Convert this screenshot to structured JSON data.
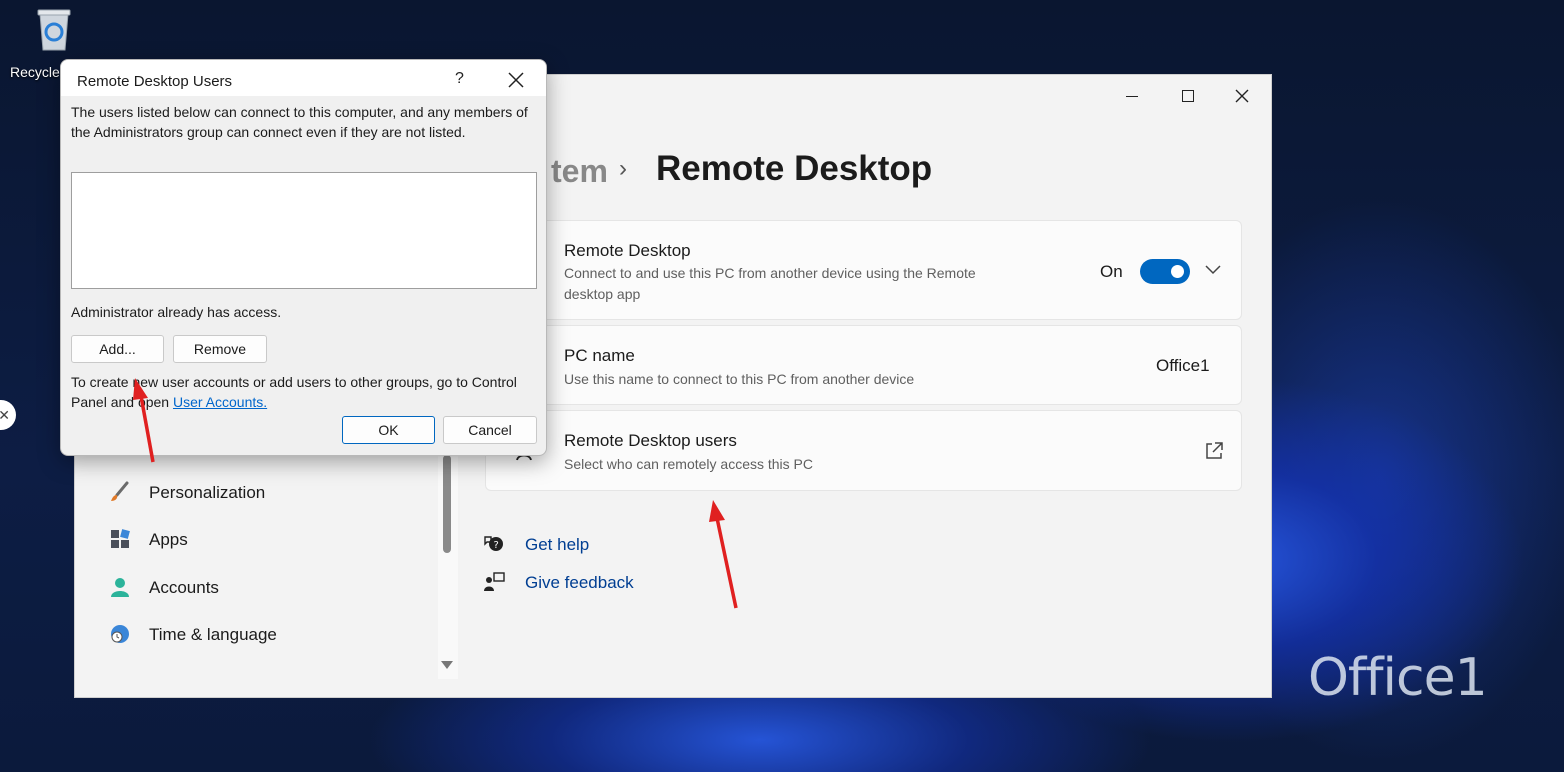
{
  "desktop": {
    "recycle_label": "Recycle",
    "watermark": "Office1"
  },
  "settings": {
    "breadcrumb_prev": "tem",
    "breadcrumb_sep": "›",
    "title": "Remote Desktop",
    "remote_desktop": {
      "title": "Remote Desktop",
      "desc": "Connect to and use this PC from another device using the Remote desktop app",
      "toggle_state": "On",
      "toggle_on": true
    },
    "pc_name": {
      "title": "PC name",
      "desc": "Use this name to connect to this PC from another device",
      "value": "Office1"
    },
    "rd_users": {
      "title": "Remote Desktop users",
      "desc": "Select who can remotely access this PC"
    },
    "links": {
      "help": "Get help",
      "feedback": "Give feedback"
    },
    "nav": [
      {
        "label": "Personalization",
        "icon": "brush-icon"
      },
      {
        "label": "Apps",
        "icon": "apps-icon"
      },
      {
        "label": "Accounts",
        "icon": "person-icon"
      },
      {
        "label": "Time & language",
        "icon": "globe-clock-icon"
      }
    ]
  },
  "dialog": {
    "title": "Remote Desktop Users",
    "help": "?",
    "intro": "The users listed below can connect to this computer, and any members of the Administrators group can connect even if they are not listed.",
    "note": "Administrator already has access.",
    "add": "Add...",
    "remove": "Remove",
    "footer_text": "To create new user accounts or add users to other groups, go to Control Panel and open ",
    "footer_link": "User Accounts.",
    "ok": "OK",
    "cancel": "Cancel"
  },
  "colors": {
    "accent": "#0067c0",
    "link": "#003e92",
    "annotation_arrow": "#e02020"
  }
}
